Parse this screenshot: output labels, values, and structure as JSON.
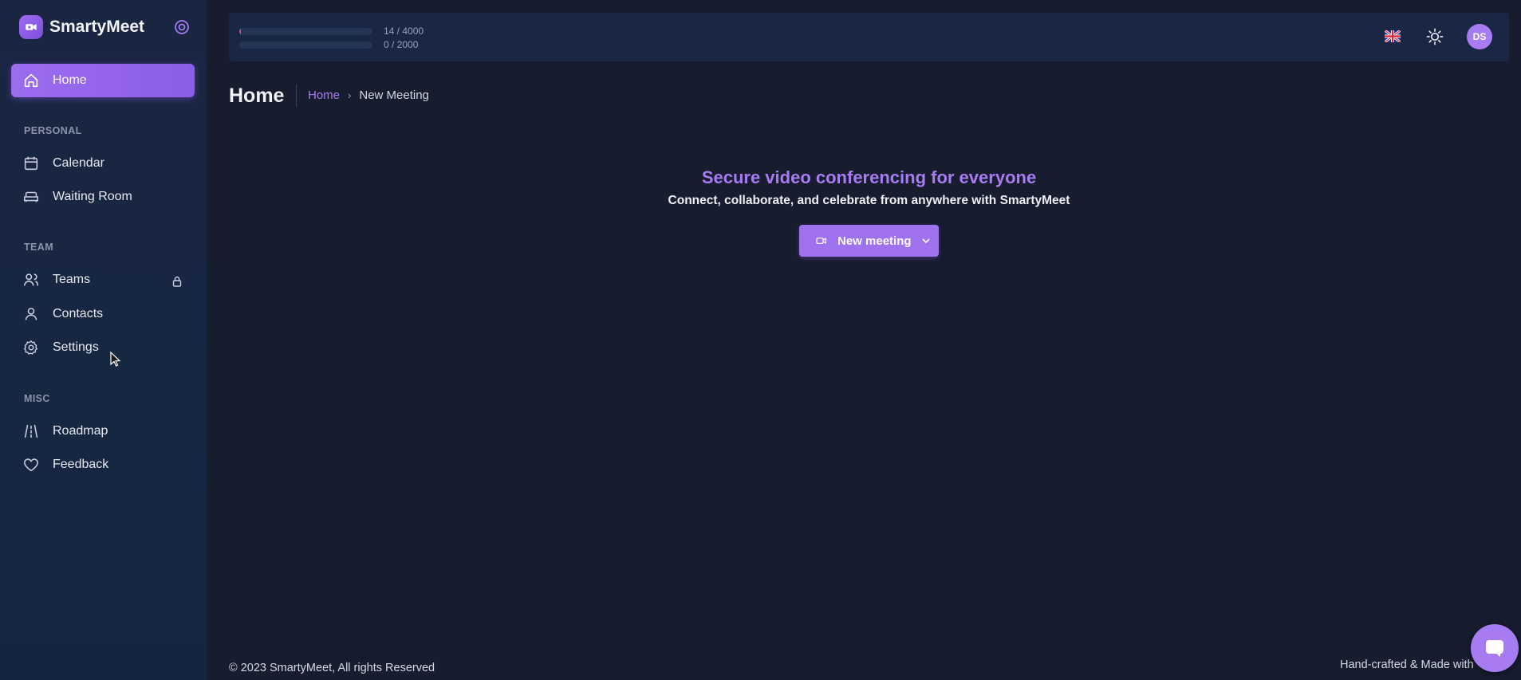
{
  "brand": {
    "name": "SmartyMeet"
  },
  "sidebar": {
    "home": "Home",
    "sections": {
      "personal": "PERSONAL",
      "team": "TEAM",
      "misc": "MISC"
    },
    "items": {
      "calendar": "Calendar",
      "waiting_room": "Waiting Room",
      "teams": "Teams",
      "contacts": "Contacts",
      "settings": "Settings",
      "roadmap": "Roadmap",
      "feedback": "Feedback"
    }
  },
  "topbar": {
    "usage": [
      {
        "text": "14 / 4000",
        "fraction": 0.0035
      },
      {
        "text": "0 / 2000",
        "fraction": 0
      }
    ],
    "avatar_initials": "DS"
  },
  "page": {
    "title": "Home",
    "breadcrumb": {
      "link": "Home",
      "current": "New Meeting"
    }
  },
  "hero": {
    "title": "Secure video conferencing for everyone",
    "subtitle": "Connect, collaborate, and celebrate from anywhere with SmartyMeet",
    "button_label": "New meeting"
  },
  "footer": {
    "copyright": "© 2023 SmartyMeet, All rights Reserved",
    "credit": "Hand-crafted & Made with"
  },
  "colors": {
    "accent": "#a77cf2",
    "background": "#171c2f",
    "sidebar": "#1a2542"
  }
}
